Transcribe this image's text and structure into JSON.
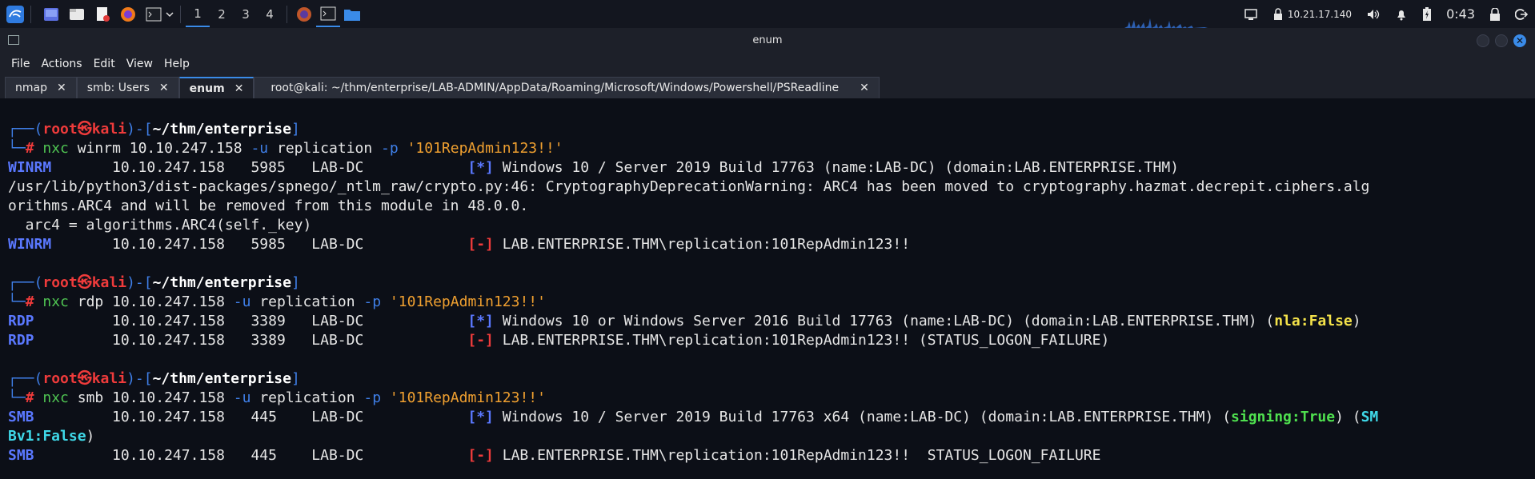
{
  "panel": {
    "workspaces": [
      "1",
      "2",
      "3",
      "4"
    ],
    "active_workspace": "1",
    "ip": "10.21.17.140",
    "clock": "0:43"
  },
  "window": {
    "title": "enum",
    "menu": [
      "File",
      "Actions",
      "Edit",
      "View",
      "Help"
    ],
    "tabs": [
      {
        "label": "nmap",
        "active": false
      },
      {
        "label": "smb: Users",
        "active": false
      },
      {
        "label": "enum",
        "active": true
      },
      {
        "label": "root@kali: ~/thm/enterprise/LAB-ADMIN/AppData/Roaming/Microsoft/Windows/Powershell/PSReadline",
        "active": false
      }
    ]
  },
  "terminal": {
    "prompt": {
      "user": "root",
      "at": "㉿",
      "host": "kali",
      "cwd": "~/thm/enterprise",
      "sym": "#"
    },
    "blocks": [
      {
        "cmd": "nxc",
        "proto": "winrm",
        "target": "10.10.247.158",
        "user_flag": "-u",
        "user": "replication",
        "pass_flag": "-p",
        "pass": "'101RepAdmin123!!'",
        "output": [
          {
            "kind": "row",
            "proto": "WINRM",
            "ip": "10.10.247.158",
            "port": "5985",
            "host": "LAB-DC",
            "tag": "[*]",
            "msg": "Windows 10 / Server 2019 Build 17763 (name:LAB-DC) (domain:LAB.ENTERPRISE.THM)"
          },
          {
            "kind": "plain",
            "text": "/usr/lib/python3/dist-packages/spnego/_ntlm_raw/crypto.py:46: CryptographyDeprecationWarning: ARC4 has been moved to cryptography.hazmat.decrepit.ciphers.alg"
          },
          {
            "kind": "plain",
            "text": "orithms.ARC4 and will be removed from this module in 48.0.0."
          },
          {
            "kind": "plain",
            "text": "  arc4 = algorithms.ARC4(self._key)"
          },
          {
            "kind": "row",
            "proto": "WINRM",
            "ip": "10.10.247.158",
            "port": "5985",
            "host": "LAB-DC",
            "tag": "[-]",
            "msg": "LAB.ENTERPRISE.THM\\replication:101RepAdmin123!!"
          }
        ]
      },
      {
        "cmd": "nxc",
        "proto": "rdp",
        "target": "10.10.247.158",
        "user_flag": "-u",
        "user": "replication",
        "pass_flag": "-p",
        "pass": "'101RepAdmin123!!'",
        "output": [
          {
            "kind": "row",
            "proto": "RDP",
            "ip": "10.10.247.158",
            "port": "3389",
            "host": "LAB-DC",
            "tag": "[*]",
            "msg": "Windows 10 or Windows Server 2016 Build 17763 (name:LAB-DC) (domain:LAB.ENTERPRISE.THM) (",
            "hl": "nla:False",
            "hl_after": ")"
          },
          {
            "kind": "row",
            "proto": "RDP",
            "ip": "10.10.247.158",
            "port": "3389",
            "host": "LAB-DC",
            "tag": "[-]",
            "msg": "LAB.ENTERPRISE.THM\\replication:101RepAdmin123!! (STATUS_LOGON_FAILURE)"
          }
        ]
      },
      {
        "cmd": "nxc",
        "proto": "smb",
        "target": "10.10.247.158",
        "user_flag": "-u",
        "user": "replication",
        "pass_flag": "-p",
        "pass": "'101RepAdmin123!!'",
        "output": [
          {
            "kind": "row",
            "proto": "SMB",
            "ip": "10.10.247.158",
            "port": "445",
            "host": "LAB-DC",
            "tag": "[*]",
            "msg": "Windows 10 / Server 2019 Build 17763 x64 (name:LAB-DC) (domain:LAB.ENTERPRISE.THM) (",
            "hl": "signing:True",
            "hl_after": ") (",
            "hl2": "SM"
          },
          {
            "kind": "wrap",
            "hl": "Bv1:False",
            "after": ")"
          },
          {
            "kind": "row",
            "proto": "SMB",
            "ip": "10.10.247.158",
            "port": "445",
            "host": "LAB-DC",
            "tag": "[-]",
            "msg": "LAB.ENTERPRISE.THM\\replication:101RepAdmin123!!  STATUS_LOGON_FAILURE"
          }
        ]
      }
    ]
  },
  "colors": {
    "accent": "#3a8be8",
    "prompt_red": "#ef3b3b",
    "path_blue": "#3f7fe8",
    "cmd_green": "#4fc352",
    "string_orange": "#f0a030"
  }
}
